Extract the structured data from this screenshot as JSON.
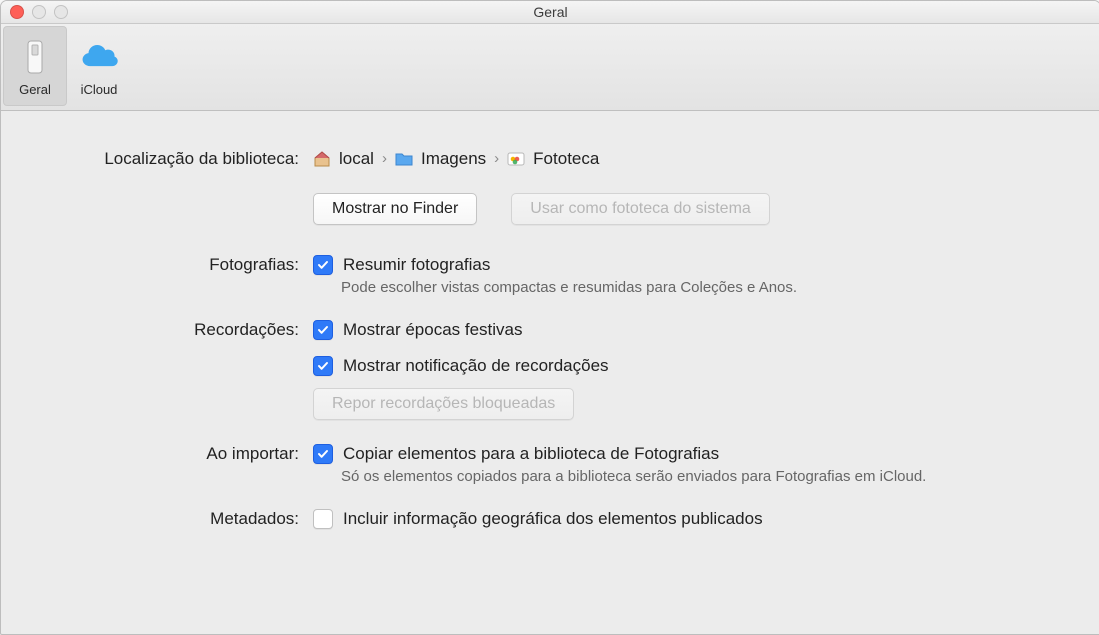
{
  "window": {
    "title": "Geral"
  },
  "tabs": {
    "geral": "Geral",
    "icloud": "iCloud"
  },
  "library": {
    "label": "Localização da biblioteca:",
    "crumb1": "local",
    "crumb2": "Imagens",
    "crumb3": "Fototeca",
    "show_in_finder": "Mostrar no Finder",
    "use_as_system": "Usar como fototeca do sistema"
  },
  "photos": {
    "label": "Fotografias:",
    "summarize": "Resumir fotografias",
    "sub": "Pode escolher vistas compactas e resumidas para Coleções e Anos."
  },
  "memories": {
    "label": "Recordações:",
    "holidays": "Mostrar épocas festivas",
    "notifications": "Mostrar notificação de recordações",
    "reset": "Repor recordações bloqueadas"
  },
  "importing": {
    "label": "Ao importar:",
    "copy": "Copiar elementos para a biblioteca de Fotografias",
    "sub": "Só os elementos copiados para a biblioteca serão enviados para Fotografias em iCloud."
  },
  "metadata": {
    "label": "Metadados:",
    "geo": "Incluir informação geográfica dos elementos publicados"
  }
}
